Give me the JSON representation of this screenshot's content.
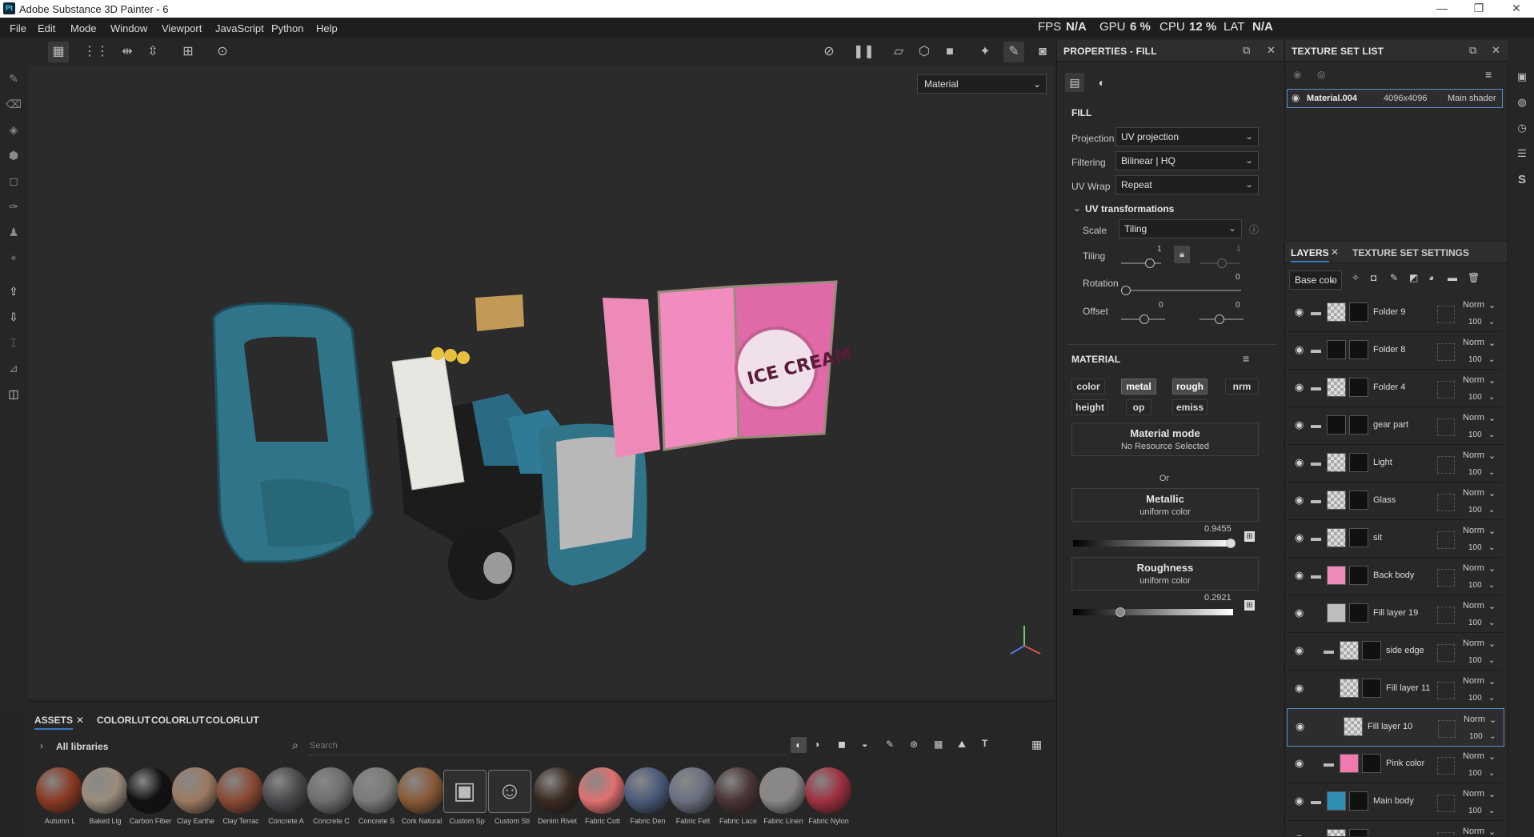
{
  "window": {
    "title": "Adobe Substance 3D Painter - 6",
    "app_icon": "Pt"
  },
  "menu": [
    "File",
    "Edit",
    "Mode",
    "Window",
    "Viewport",
    "JavaScript",
    "Python",
    "Help"
  ],
  "perf": {
    "fps_label": "FPS",
    "fps": "N/A",
    "gpu_label": "GPU",
    "gpu": "6 %",
    "cpu_label": "CPU",
    "cpu": "12 %",
    "lat_label": "LAT",
    "lat": "N/A"
  },
  "viewport": {
    "mode": "Material"
  },
  "props": {
    "title": "PROPERTIES - FILL",
    "section": "FILL",
    "projection_label": "Projection",
    "projection": "UV projection",
    "filtering_label": "Filtering",
    "filtering": "Bilinear | HQ",
    "uvwrap_label": "UV Wrap",
    "uvwrap": "Repeat",
    "uvtrans_label": "UV transformations",
    "scale_label": "Scale",
    "scale": "Tiling",
    "tiling_label": "Tiling",
    "tiling_a": "1",
    "tiling_b": "1",
    "rotation_label": "Rotation",
    "rotation": "0",
    "offset_label": "Offset",
    "offset_a": "0",
    "offset_b": "0",
    "material_label": "MATERIAL",
    "channels": [
      "color",
      "metal",
      "rough",
      "nrm",
      "height",
      "op",
      "emiss"
    ],
    "matmode_title": "Material mode",
    "matmode_value": "No Resource Selected",
    "or_label": "Or",
    "metallic_title": "Metallic",
    "metallic_sub": "uniform color",
    "metallic_value": "0.9455",
    "roughness_title": "Roughness",
    "roughness_sub": "uniform color",
    "roughness_value": "0.2921"
  },
  "texture_set": {
    "title": "TEXTURE SET LIST",
    "name": "Material.004",
    "res": "4096x4096",
    "shader": "Main shader"
  },
  "layers": {
    "tab_layers": "LAYERS",
    "tab_settings": "TEXTURE SET SETTINGS",
    "channel": "Base colo",
    "items": [
      {
        "name": "Folder 9",
        "blend": "Norm",
        "opacity": "100"
      },
      {
        "name": "Folder 8",
        "blend": "Norm",
        "opacity": "100"
      },
      {
        "name": "Folder 4",
        "blend": "Norm",
        "opacity": "100"
      },
      {
        "name": "gear part",
        "blend": "Norm",
        "opacity": "100"
      },
      {
        "name": "Light",
        "blend": "Norm",
        "opacity": "100"
      },
      {
        "name": "Glass",
        "blend": "Norm",
        "opacity": "100"
      },
      {
        "name": "sit",
        "blend": "Norm",
        "opacity": "100"
      },
      {
        "name": "Back body",
        "blend": "Norm",
        "opacity": "100"
      },
      {
        "name": "Fill layer 19",
        "blend": "Norm",
        "opacity": "100"
      },
      {
        "name": "side edge",
        "blend": "Norm",
        "opacity": "100"
      },
      {
        "name": "Fill layer 11",
        "blend": "Norm",
        "opacity": "100"
      },
      {
        "name": "Fill layer 10",
        "blend": "Norm",
        "opacity": "100"
      },
      {
        "name": "Pink color",
        "blend": "Norm",
        "opacity": "100"
      },
      {
        "name": "Main body",
        "blend": "Norm",
        "opacity": "100"
      },
      {
        "name": "",
        "blend": "Norm",
        "opacity": ""
      }
    ]
  },
  "assets": {
    "tabs": [
      "ASSETS",
      "COLORLUT",
      "COLORLUT",
      "COLORLUT"
    ],
    "library": "All libraries",
    "search_placeholder": "Search",
    "items": [
      {
        "label": "Autumn L",
        "color": "#8a3a22"
      },
      {
        "label": "Baked Lig",
        "color": "#9a8c7c"
      },
      {
        "label": "Carbon Fiber",
        "color": "#111111"
      },
      {
        "label": "Clay Earthe",
        "color": "#9c7a62"
      },
      {
        "label": "Clay Terrac",
        "color": "#8a4a34"
      },
      {
        "label": "Concrete A",
        "color": "#4a4a4e"
      },
      {
        "label": "Concrete C",
        "color": "#6e6e70"
      },
      {
        "label": "Concrete S",
        "color": "#7a7a78"
      },
      {
        "label": "Cork Natural",
        "color": "#8a5a38"
      },
      {
        "label": "Custom Sp",
        "color": "#2e2e2e"
      },
      {
        "label": "Custom Sti",
        "color": "#2e2e2e"
      },
      {
        "label": "Denim Rivet",
        "color": "#3a2a22"
      },
      {
        "label": "Fabric Cott",
        "color": "#e07070"
      },
      {
        "label": "Fabric Den",
        "color": "#4a5a7a"
      },
      {
        "label": "Fabric Felt",
        "color": "#6a7080"
      },
      {
        "label": "Fabric Lace",
        "color": "#4a3434"
      },
      {
        "label": "Fabric Linen",
        "color": "#8a8886"
      },
      {
        "label": "Fabric Nylon",
        "color": "#a03040"
      }
    ]
  }
}
